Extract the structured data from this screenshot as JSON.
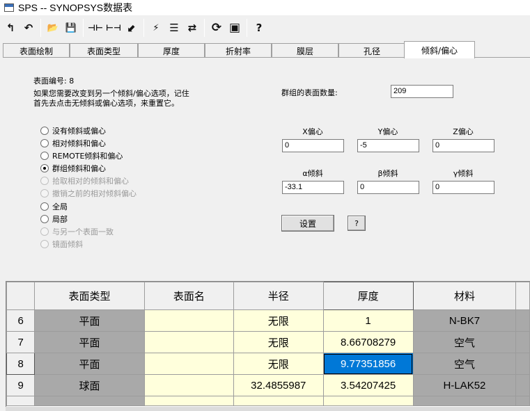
{
  "window": {
    "title": "SPS -- SYNOPSYS数据表"
  },
  "toolbar": {
    "buttons": [
      {
        "icon": "undo-arrow-icon",
        "glyph": "↰"
      },
      {
        "icon": "redo-arrow-icon",
        "glyph": "↶"
      },
      {
        "icon": "open-folder-icon",
        "glyph": "📂"
      },
      {
        "icon": "save-disk-icon",
        "glyph": "💾"
      },
      {
        "icon": "insert-surface-icon",
        "glyph": "⊣⊢"
      },
      {
        "icon": "delete-surface-icon",
        "glyph": "⊢⊣"
      },
      {
        "icon": "pick-tool-icon",
        "glyph": "⬋"
      },
      {
        "icon": "ray-trace-icon",
        "glyph": "⚡"
      },
      {
        "icon": "spreadsheet-icon",
        "glyph": "☰"
      },
      {
        "icon": "adjust-sliders-icon",
        "glyph": "⇄"
      },
      {
        "icon": "refresh-icon",
        "glyph": "⟳"
      },
      {
        "icon": "window-icon",
        "glyph": "▣"
      },
      {
        "icon": "help-icon",
        "glyph": "?"
      }
    ]
  },
  "tabs": [
    {
      "label": "表面绘制",
      "active": false
    },
    {
      "label": "表面类型",
      "active": false
    },
    {
      "label": "厚度",
      "active": false
    },
    {
      "label": "折射率",
      "active": false
    },
    {
      "label": "膜层",
      "active": false
    },
    {
      "label": "孔径",
      "active": false
    },
    {
      "label": "倾斜/偏心",
      "active": true
    }
  ],
  "panel": {
    "surface_number": "表面编号: 8",
    "note_line1": "如果您需要改变到另一个倾斜/偏心选项，记住",
    "note_line2": "首先去点击无倾斜或偏心选项，来重置它。",
    "group_count_label": "群组的表面数量:",
    "group_count_value": "209",
    "options": [
      {
        "label": "没有倾斜或偏心",
        "checked": false,
        "disabled": false
      },
      {
        "label": "相对倾斜和偏心",
        "checked": false,
        "disabled": false
      },
      {
        "label": "REMOTE倾斜和偏心",
        "checked": false,
        "disabled": false
      },
      {
        "label": "群组倾斜和偏心",
        "checked": true,
        "disabled": false
      },
      {
        "label": "拾取相对的倾斜和偏心",
        "checked": false,
        "disabled": true
      },
      {
        "label": "撤销之前的相对倾斜偏心",
        "checked": false,
        "disabled": true
      },
      {
        "label": "全局",
        "checked": false,
        "disabled": false
      },
      {
        "label": "局部",
        "checked": false,
        "disabled": false
      },
      {
        "label": "与另一个表面一致",
        "checked": false,
        "disabled": true
      },
      {
        "label": "镜面倾斜",
        "checked": false,
        "disabled": true
      }
    ],
    "decenter": {
      "x_label": "X偏心",
      "y_label": "Y偏心",
      "z_label": "Z偏心",
      "x": "0",
      "y": "-5",
      "z": "0"
    },
    "tilt": {
      "alpha_label": "α倾斜",
      "beta_label": "β倾斜",
      "gamma_label": "γ倾斜",
      "alpha": "-33.1",
      "beta": "0",
      "gamma": "0"
    },
    "set_button": "设置",
    "help_button": "?"
  },
  "grid": {
    "columns": [
      "",
      "表面类型",
      "表面名",
      "半径",
      "厚度",
      "材料"
    ],
    "rows": [
      {
        "num": "6",
        "type": "平面",
        "name": "",
        "radius": "无限",
        "thickness": "1",
        "material": "N-BK7"
      },
      {
        "num": "7",
        "type": "平面",
        "name": "",
        "radius": "无限",
        "thickness": "8.66708279",
        "material": "空气"
      },
      {
        "num": "8",
        "type": "平面",
        "name": "",
        "radius": "无限",
        "thickness": "9.77351856",
        "material": "空气",
        "selected_cell": "thickness"
      },
      {
        "num": "9",
        "type": "球面",
        "name": "",
        "radius": "32.4855987",
        "thickness": "3.54207425",
        "material": "H-LAK52"
      }
    ]
  },
  "colors": {
    "selection": "#0078d7",
    "gray_cell": "#a9a9a9",
    "cream_cell": "#ffffdc"
  }
}
